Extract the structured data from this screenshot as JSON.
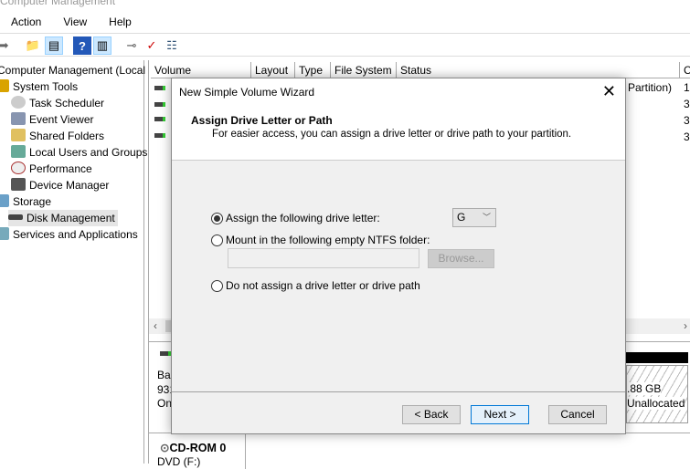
{
  "window": {
    "title": "Computer Management"
  },
  "menu": [
    "Action",
    "View",
    "Help"
  ],
  "toolbar_icons": [
    "forward-arrow-icon",
    "up-folder-icon",
    "show-hide-tree-icon",
    "help-icon",
    "action-pane-icon",
    "connect-icon",
    "check-icon",
    "properties-icon"
  ],
  "tree": {
    "root": "Computer Management (Local",
    "items": [
      {
        "label": "System Tools",
        "level": 0
      },
      {
        "label": "Task Scheduler",
        "level": 1
      },
      {
        "label": "Event Viewer",
        "level": 1
      },
      {
        "label": "Shared Folders",
        "level": 1
      },
      {
        "label": "Local Users and Groups",
        "level": 1
      },
      {
        "label": "Performance",
        "level": 1
      },
      {
        "label": "Device Manager",
        "level": 1
      },
      {
        "label": "Storage",
        "level": 0
      },
      {
        "label": "Disk Management",
        "level": 1,
        "selected": true
      },
      {
        "label": "Services and Applications",
        "level": 0
      }
    ]
  },
  "table": {
    "columns": [
      "Volume",
      "Layout",
      "Type",
      "File System",
      "Status",
      "C"
    ],
    "visible_fragments": [
      "Partition)",
      "1",
      "3",
      "3",
      "3"
    ]
  },
  "disks": {
    "disk0": [
      "Bas",
      "931",
      "On"
    ],
    "unallocated_size": ".88 GB",
    "unallocated_label": "Unallocated",
    "cdrom": "CD-ROM 0",
    "cdrom_sub": "DVD (F:)"
  },
  "dialog": {
    "title": "New Simple Volume Wizard",
    "heading": "Assign Drive Letter or Path",
    "subheading": "For easier access, you can assign a drive letter or drive path to your partition.",
    "options": {
      "assign": "Assign the following drive letter:",
      "mount": "Mount in the following empty NTFS folder:",
      "none": "Do not assign a drive letter or drive path"
    },
    "selected_option": "assign",
    "drive_letter": "G",
    "browse": "Browse...",
    "mount_path": "",
    "buttons": {
      "back": "< Back",
      "next": "Next >",
      "cancel": "Cancel"
    }
  }
}
